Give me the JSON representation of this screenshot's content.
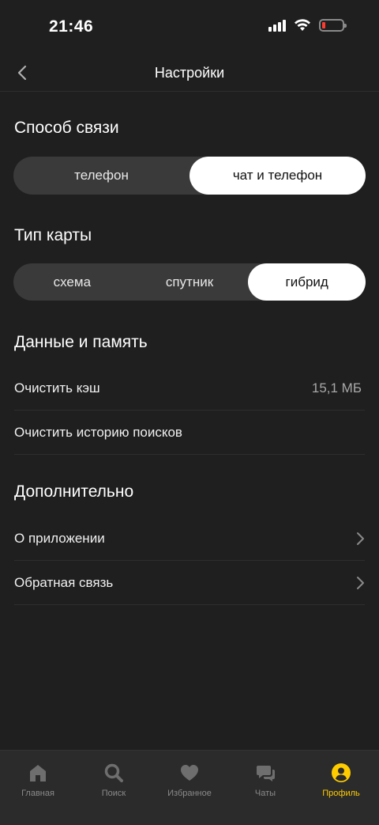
{
  "status_bar": {
    "time": "21:46"
  },
  "header": {
    "title": "Настройки"
  },
  "contact_method": {
    "title": "Способ связи",
    "options": [
      "телефон",
      "чат и телефон"
    ],
    "selected": "чат и телефон"
  },
  "map_type": {
    "title": "Тип карты",
    "options": [
      "схема",
      "спутник",
      "гибрид"
    ],
    "selected": "гибрид"
  },
  "data_memory": {
    "title": "Данные и память",
    "clear_cache_label": "Очистить кэш",
    "cache_size": "15,1 МБ",
    "clear_history_label": "Очистить историю поисков"
  },
  "additional": {
    "title": "Дополнительно",
    "about_label": "О приложении",
    "feedback_label": "Обратная связь"
  },
  "tab_bar": {
    "items": [
      {
        "label": "Главная",
        "icon": "home-icon"
      },
      {
        "label": "Поиск",
        "icon": "search-icon"
      },
      {
        "label": "Избранное",
        "icon": "heart-icon"
      },
      {
        "label": "Чаты",
        "icon": "chat-icon"
      },
      {
        "label": "Профиль",
        "icon": "profile-icon"
      }
    ],
    "active": "Профиль"
  },
  "colors": {
    "background": "#1f1f1f",
    "accent": "#ffcc00",
    "segment_active": "#ffffff",
    "segment_bg": "#3a3a3a"
  }
}
